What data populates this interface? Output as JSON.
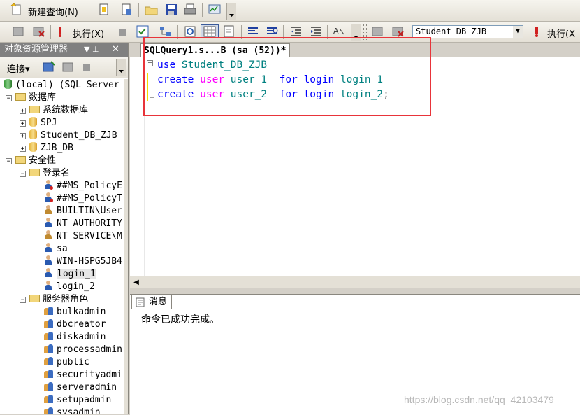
{
  "toolbar1": {
    "new_query_label": "新建查询(N)",
    "icons": [
      "new-query-icon",
      "new-file-icon",
      "new-project-icon",
      "open-file-icon",
      "save-icon",
      "print-icon",
      "activity-monitor-icon"
    ]
  },
  "toolbar2": {
    "execute_label": "执行(X)",
    "database_combo": "Student_DB_ZJB",
    "execute_label_right": "执行(X"
  },
  "object_explorer": {
    "title": "对象资源管理器",
    "pin_glyph": "▼ ⊥",
    "close_glyph": "✕",
    "connect_label": "连接▾",
    "tree": [
      {
        "label": "(local) (SQL Server",
        "type": "server",
        "level": 0,
        "expander": ""
      },
      {
        "label": "数据库",
        "type": "folder",
        "level": 0,
        "expander": "−"
      },
      {
        "label": "系统数据库",
        "type": "folder",
        "level": 1,
        "expander": "+"
      },
      {
        "label": "SPJ",
        "type": "db",
        "level": 1,
        "expander": "+"
      },
      {
        "label": "Student_DB_ZJB",
        "type": "db",
        "level": 1,
        "expander": "+"
      },
      {
        "label": "ZJB_DB",
        "type": "db",
        "level": 1,
        "expander": "+"
      },
      {
        "label": "安全性",
        "type": "folder",
        "level": 0,
        "expander": "−"
      },
      {
        "label": "登录名",
        "type": "folder",
        "level": 1,
        "expander": "−"
      },
      {
        "label": "##MS_PolicyE",
        "type": "user-disabled",
        "level": 2,
        "expander": ""
      },
      {
        "label": "##MS_PolicyT",
        "type": "user-disabled",
        "level": 2,
        "expander": ""
      },
      {
        "label": "BUILTIN\\User",
        "type": "group",
        "level": 2,
        "expander": ""
      },
      {
        "label": "NT AUTHORITY",
        "type": "user",
        "level": 2,
        "expander": ""
      },
      {
        "label": "NT SERVICE\\M",
        "type": "group",
        "level": 2,
        "expander": ""
      },
      {
        "label": "sa",
        "type": "user",
        "level": 2,
        "expander": ""
      },
      {
        "label": "WIN-HSPG5JB4",
        "type": "user",
        "level": 2,
        "expander": ""
      },
      {
        "label": "login_1",
        "type": "user",
        "level": 2,
        "expander": "",
        "selected": true
      },
      {
        "label": "login_2",
        "type": "user",
        "level": 2,
        "expander": ""
      },
      {
        "label": "服务器角色",
        "type": "folder",
        "level": 1,
        "expander": "−"
      },
      {
        "label": "bulkadmin",
        "type": "role",
        "level": 2,
        "expander": ""
      },
      {
        "label": "dbcreator",
        "type": "role",
        "level": 2,
        "expander": ""
      },
      {
        "label": "diskadmin",
        "type": "role",
        "level": 2,
        "expander": ""
      },
      {
        "label": "processadmin",
        "type": "role",
        "level": 2,
        "expander": ""
      },
      {
        "label": "public",
        "type": "role",
        "level": 2,
        "expander": ""
      },
      {
        "label": "securityadmi",
        "type": "role",
        "level": 2,
        "expander": ""
      },
      {
        "label": "serveradmin",
        "type": "role",
        "level": 2,
        "expander": ""
      },
      {
        "label": "setupadmin",
        "type": "role",
        "level": 2,
        "expander": ""
      },
      {
        "label": "sysadmin",
        "type": "role",
        "level": 2,
        "expander": ""
      }
    ]
  },
  "editor": {
    "tab_title": "SQLQuery1.s...B (sa (52))*",
    "lines": [
      [
        {
          "t": "use",
          "c": "kw"
        },
        {
          "t": " Student_DB_ZJB",
          "c": "tl"
        }
      ],
      [
        {
          "t": "create",
          "c": "kw"
        },
        {
          "t": " ",
          "c": ""
        },
        {
          "t": "user",
          "c": "pk"
        },
        {
          "t": " user_1  ",
          "c": "tl"
        },
        {
          "t": "for",
          "c": "kw"
        },
        {
          "t": " ",
          "c": ""
        },
        {
          "t": "login",
          "c": "kw"
        },
        {
          "t": " login_1",
          "c": "tl"
        }
      ],
      [
        {
          "t": "create",
          "c": "kw"
        },
        {
          "t": " ",
          "c": ""
        },
        {
          "t": "user",
          "c": "pk"
        },
        {
          "t": " user_2  ",
          "c": "tl"
        },
        {
          "t": "for",
          "c": "kw"
        },
        {
          "t": " ",
          "c": ""
        },
        {
          "t": "login",
          "c": "kw"
        },
        {
          "t": " login_2",
          "c": "tl"
        },
        {
          "t": ";",
          "c": "gr"
        }
      ]
    ]
  },
  "results": {
    "messages_tab": "消息",
    "message_text": "命令已成功完成。"
  },
  "watermark": "https://blog.csdn.net/qq_42103479",
  "colors": {
    "keyword": "#0000ff",
    "function_kw": "#ff00ff",
    "identifier": "#008080",
    "annotation_box": "#e8343a"
  }
}
